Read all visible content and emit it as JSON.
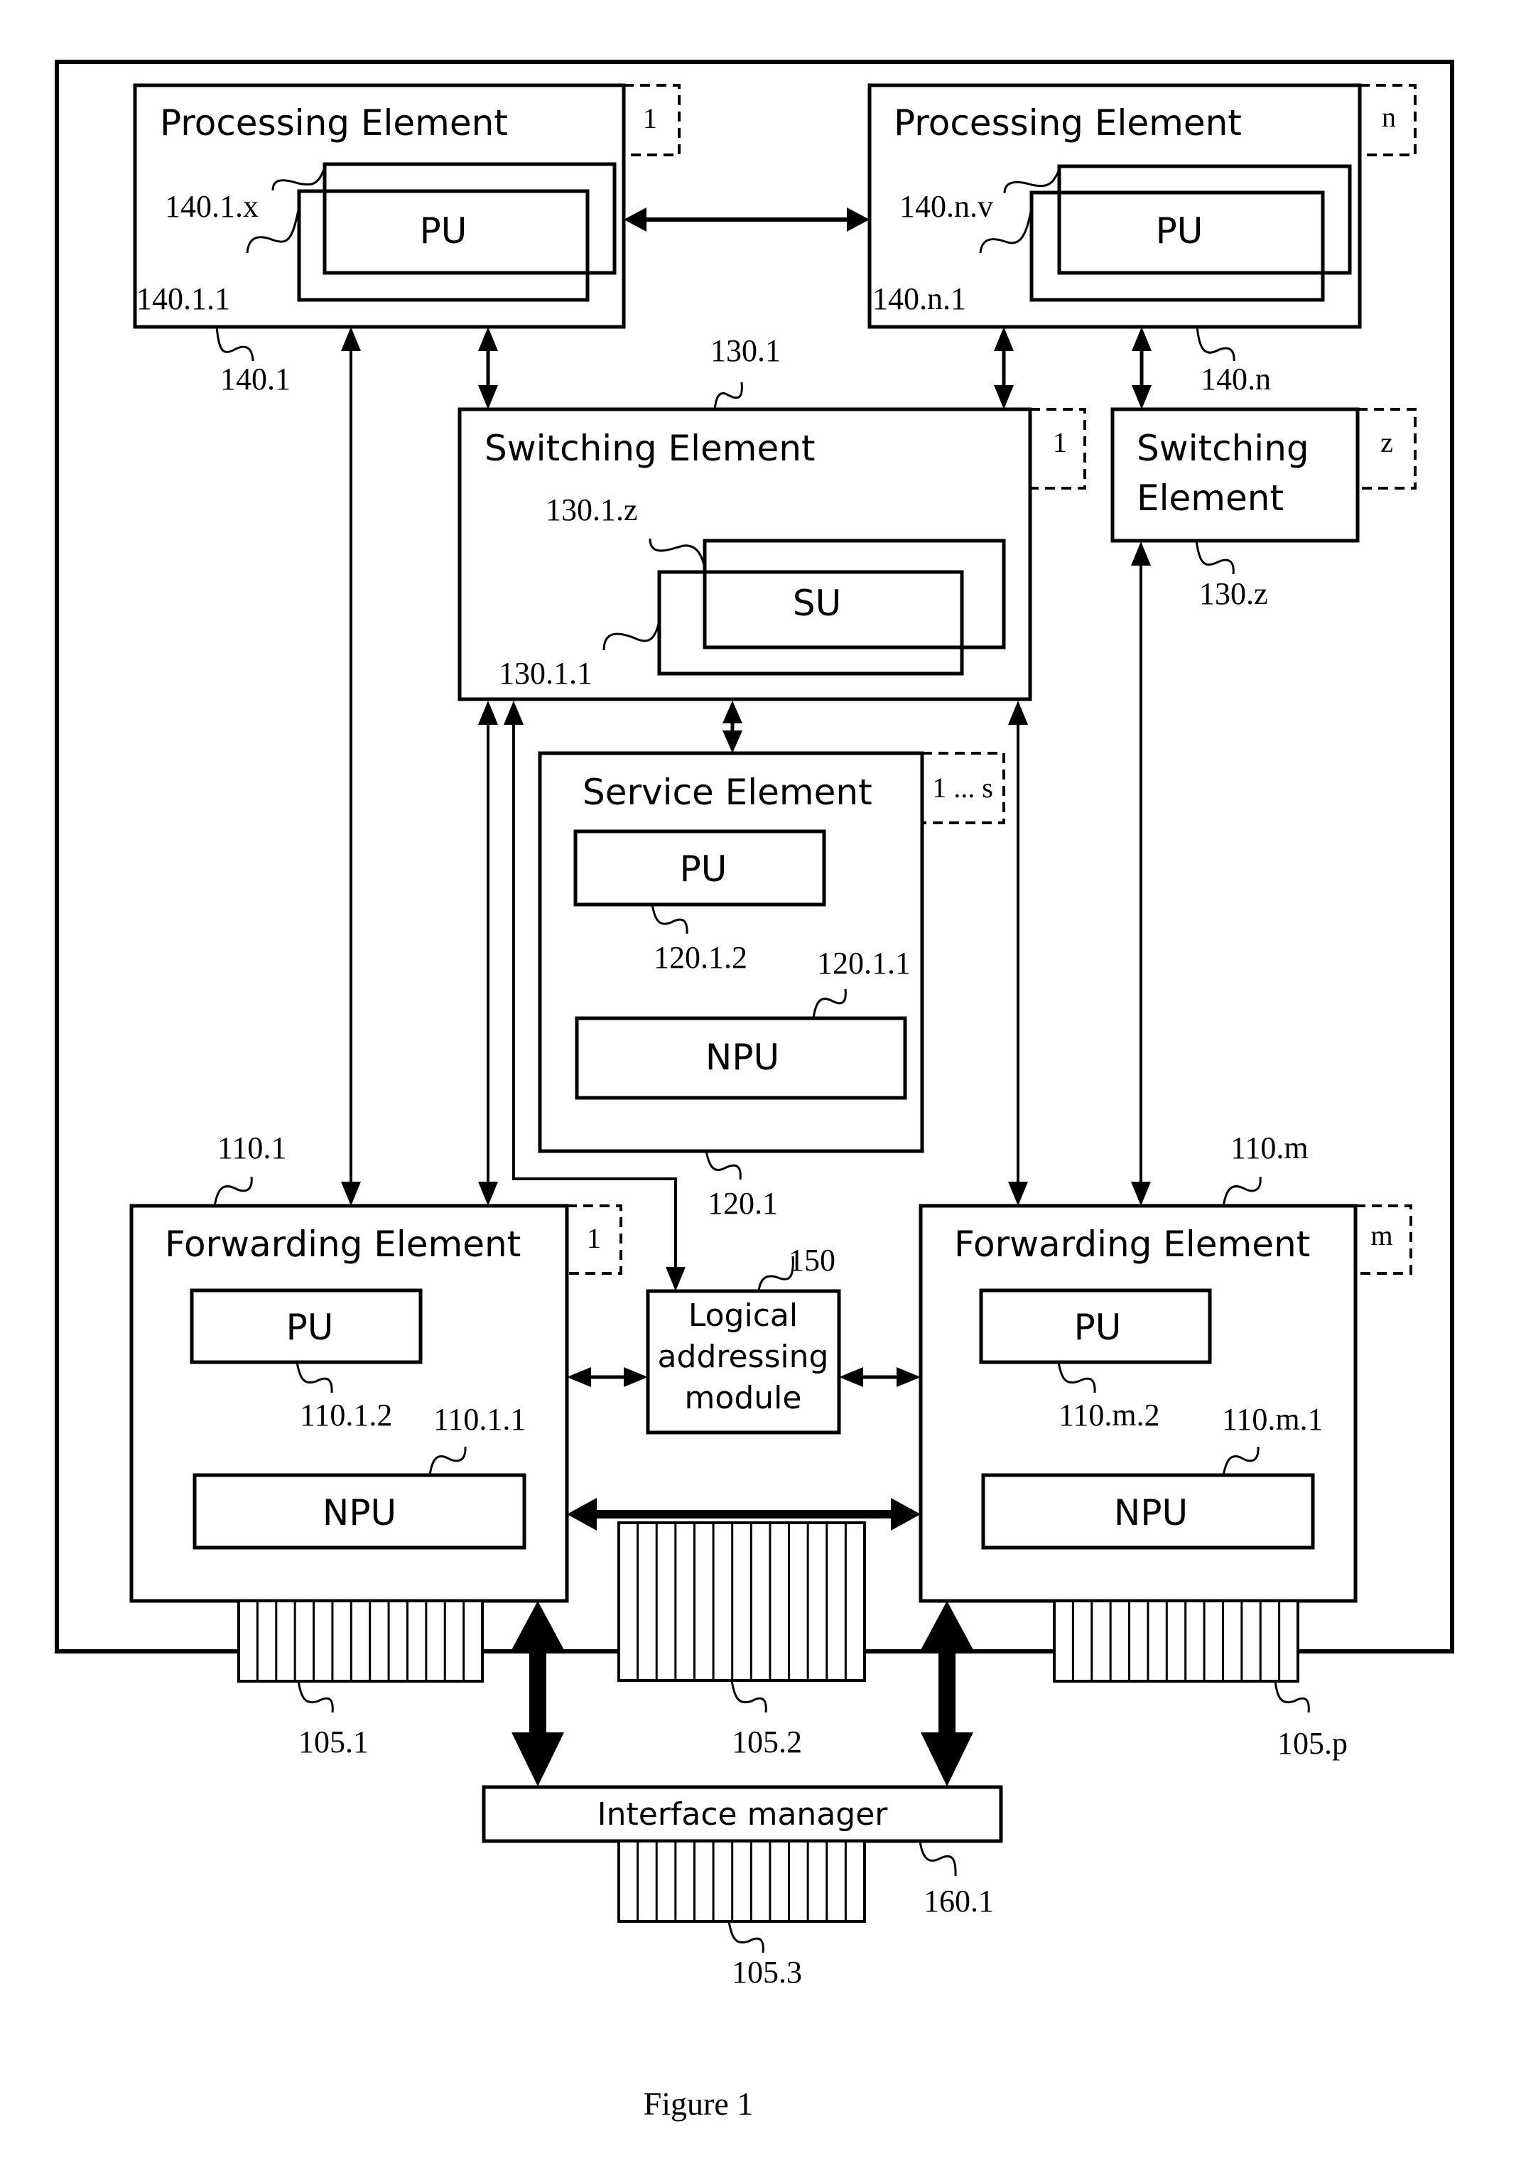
{
  "figure": {
    "caption": "Figure 1"
  },
  "processing_elements": [
    {
      "title": "Processing Element",
      "multiplicity": "1",
      "ref": "140.1",
      "unit_label": "PU",
      "unit_ref_front": "140.1.1",
      "unit_ref_back": "140.1.x"
    },
    {
      "title": "Processing Element",
      "multiplicity": "n",
      "ref": "140.n",
      "unit_label": "PU",
      "unit_ref_front": "140.n.1",
      "unit_ref_back": "140.n.v"
    }
  ],
  "switching_elements": [
    {
      "title": "Switching Element",
      "multiplicity": "1",
      "ref": "130.1",
      "unit_label": "SU",
      "unit_ref_front": "130.1.1",
      "unit_ref_back": "130.1.z"
    },
    {
      "title_line1": "Switching",
      "title_line2": "Element",
      "multiplicity": "z",
      "ref": "130.z"
    }
  ],
  "service_element": {
    "title": "Service Element",
    "multiplicity": "1 ... s",
    "ref": "120.1",
    "pu_label": "PU",
    "pu_ref": "120.1.2",
    "npu_label": "NPU",
    "npu_ref": "120.1.1"
  },
  "forwarding_elements": [
    {
      "title": "Forwarding Element",
      "multiplicity": "1",
      "ref": "110.1",
      "pu_label": "PU",
      "pu_ref": "110.1.2",
      "npu_label": "NPU",
      "npu_ref": "110.1.1"
    },
    {
      "title": "Forwarding Element",
      "multiplicity": "m",
      "ref": "110.m",
      "pu_label": "PU",
      "pu_ref": "110.m.2",
      "npu_label": "NPU",
      "npu_ref": "110.m.1"
    }
  ],
  "logical_addressing_module": {
    "line1": "Logical",
    "line2": "addressing",
    "line3": "module",
    "ref": "150"
  },
  "interface_manager": {
    "label": "Interface manager",
    "ref": "160.1"
  },
  "ports": [
    {
      "ref": "105.1",
      "cells": 13
    },
    {
      "ref": "105.2",
      "cells": 13
    },
    {
      "ref": "105.p",
      "cells": 13
    },
    {
      "ref": "105.3",
      "cells": 13
    }
  ]
}
